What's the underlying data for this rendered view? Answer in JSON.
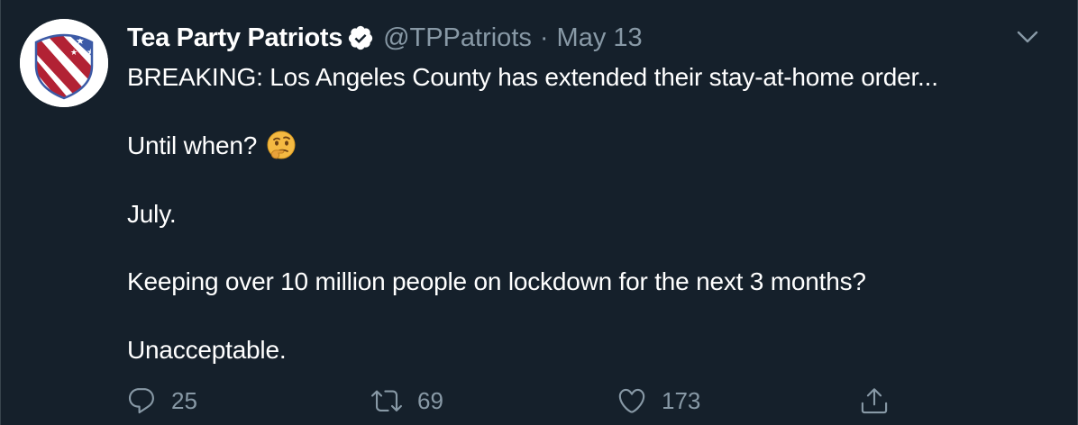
{
  "tweet": {
    "display_name": "Tea Party Patriots",
    "verified_icon": "verified-badge-icon",
    "handle": "@TPPatriots",
    "separator": "·",
    "date": "May 13",
    "menu_icon": "chevron-down-icon",
    "lines": [
      "BREAKING: Los Angeles County has extended their stay-at-home order...",
      "Until when?",
      "July.",
      "Keeping over 10 million people on lockdown for the next 3 months?",
      "Unacceptable."
    ],
    "emoji": "thinking-face-emoji",
    "actions": {
      "reply_count": "25",
      "retweet_count": "69",
      "like_count": "173"
    },
    "colors": {
      "background": "#15202b",
      "text": "#ffffff",
      "secondary": "#8899a6",
      "verified": "#ffffff",
      "avatar_red": "#b22234",
      "avatar_blue": "#3c5aa6"
    }
  }
}
